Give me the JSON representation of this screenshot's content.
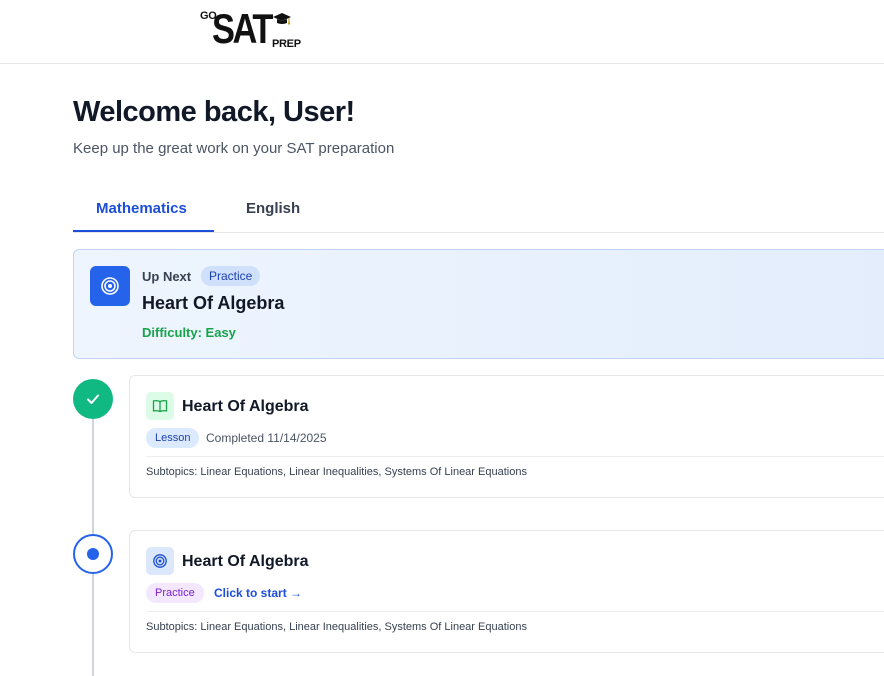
{
  "brand": {
    "go": "GO",
    "sat": "SAT",
    "prep": "PREP"
  },
  "header": {
    "welcome": "Welcome back, User!",
    "subtitle": "Keep up the great work on your SAT preparation"
  },
  "tabs": [
    {
      "label": "Mathematics",
      "active": true
    },
    {
      "label": "English",
      "active": false
    }
  ],
  "up_next": {
    "label": "Up Next",
    "badge": "Practice",
    "title": "Heart Of Algebra",
    "difficulty": "Difficulty: Easy",
    "icon": "target-icon"
  },
  "timeline": [
    {
      "status": "completed",
      "icon": "book-icon",
      "title": "Heart Of Algebra",
      "type": "Lesson",
      "meta": "Completed 11/14/2025",
      "subtopics": "Subtopics: Linear Equations, Linear Inequalities, Systems Of Linear Equations"
    },
    {
      "status": "current",
      "icon": "target-icon",
      "title": "Heart Of Algebra",
      "type": "Practice",
      "meta": "Click to start →",
      "subtopics": "Subtopics: Linear Equations, Linear Inequalities, Systems Of Linear Equations"
    }
  ],
  "colors": {
    "accent": "#2563eb",
    "success": "#10b981",
    "difficulty_easy": "#16a34a",
    "practice_pill": "#f3e8ff"
  }
}
